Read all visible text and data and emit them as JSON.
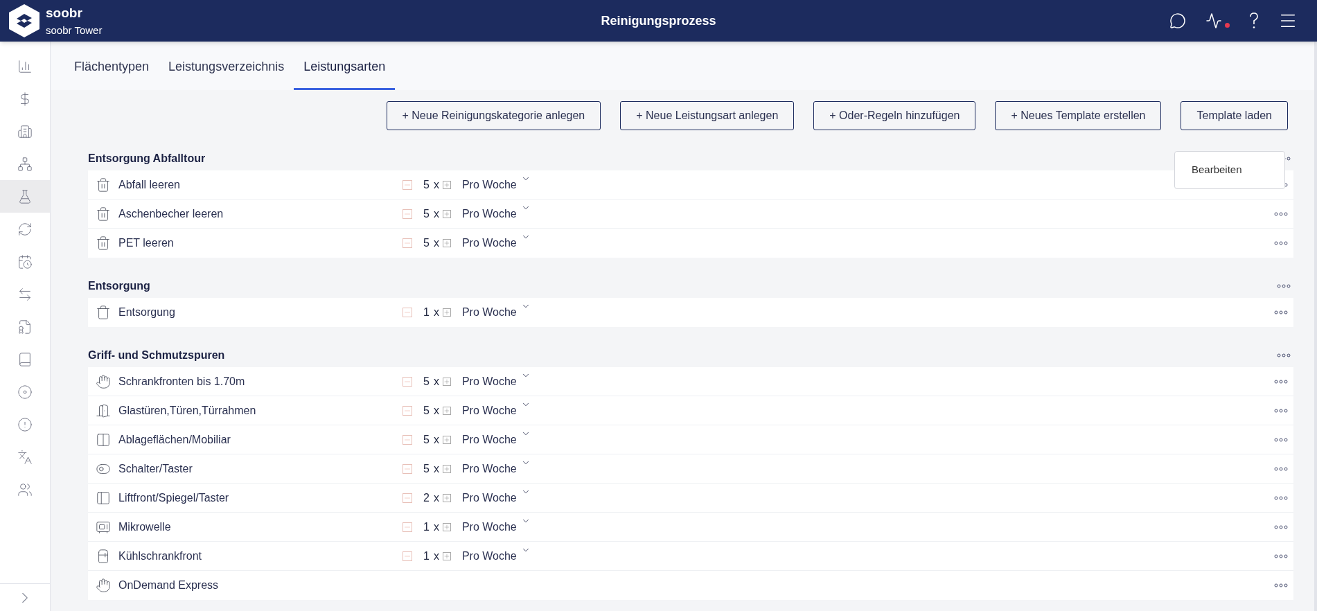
{
  "header": {
    "brand": "soobr",
    "site": "soobr Tower",
    "title": "Reinigungsprozess",
    "notification_dot": true
  },
  "sidebar": {
    "items": [
      {
        "kind": "chart",
        "selected": false
      },
      {
        "kind": "dollar",
        "selected": false
      },
      {
        "kind": "buildings",
        "selected": false
      },
      {
        "kind": "hierarchy",
        "selected": false
      },
      {
        "kind": "flask",
        "selected": true
      },
      {
        "kind": "cycle",
        "selected": false
      },
      {
        "kind": "calendar",
        "selected": false
      },
      {
        "kind": "swap",
        "selected": false
      },
      {
        "kind": "certificate",
        "selected": false
      },
      {
        "kind": "book",
        "selected": false
      },
      {
        "kind": "target",
        "selected": false
      },
      {
        "kind": "alert",
        "selected": false
      },
      {
        "kind": "translate",
        "selected": false
      },
      {
        "kind": "team",
        "selected": false
      }
    ]
  },
  "tabs": [
    {
      "label": "Flächentypen",
      "selected": false
    },
    {
      "label": "Leistungsverzeichnis",
      "selected": false
    },
    {
      "label": "Leistungsarten",
      "selected": true
    }
  ],
  "buttons": [
    "+ Neue Reinigungskategorie anlegen",
    "+ Neue Leistungsart anlegen",
    "+ Oder-Regeln hinzufügen",
    "+ Neues Template erstellen",
    "Template laden"
  ],
  "context_menu": {
    "items": [
      "Bearbeiten"
    ]
  },
  "categories": [
    {
      "name": "Entsorgung Abfalltour",
      "rows": [
        {
          "kind": "trash",
          "name": "Abfall leeren",
          "count": "5",
          "unit": "x",
          "frequency": "Pro Woche"
        },
        {
          "kind": "trash",
          "name": "Aschenbecher leeren",
          "count": "5",
          "unit": "x",
          "frequency": "Pro Woche"
        },
        {
          "kind": "trash",
          "name": "PET leeren",
          "count": "5",
          "unit": "x",
          "frequency": "Pro Woche"
        }
      ]
    },
    {
      "name": "Entsorgung",
      "rows": [
        {
          "kind": "bin",
          "name": "Entsorgung",
          "count": "1",
          "unit": "x",
          "frequency": "Pro Woche"
        }
      ]
    },
    {
      "name": "Griff- und Schmutzspuren",
      "rows": [
        {
          "kind": "hand",
          "name": "Schrankfronten bis 1.70m",
          "count": "5",
          "unit": "x",
          "frequency": "Pro Woche"
        },
        {
          "kind": "door",
          "name": "Glastüren,Türen,Türrahmen",
          "count": "5",
          "unit": "x",
          "frequency": "Pro Woche"
        },
        {
          "kind": "shelf",
          "name": "Ablageflächen/Mobiliar",
          "count": "5",
          "unit": "x",
          "frequency": "Pro Woche"
        },
        {
          "kind": "switch",
          "name": "Schalter/Taster",
          "count": "5",
          "unit": "x",
          "frequency": "Pro Woche"
        },
        {
          "kind": "lift",
          "name": "Liftfront/Spiegel/Taster",
          "count": "2",
          "unit": "x",
          "frequency": "Pro Woche"
        },
        {
          "kind": "microwave",
          "name": "Mikrowelle",
          "count": "1",
          "unit": "x",
          "frequency": "Pro Woche"
        },
        {
          "kind": "fridge",
          "name": "Kühlschrankfront",
          "count": "1",
          "unit": "x",
          "frequency": "Pro Woche"
        },
        {
          "kind": "hand",
          "name": "OnDemand Express"
        }
      ]
    }
  ]
}
